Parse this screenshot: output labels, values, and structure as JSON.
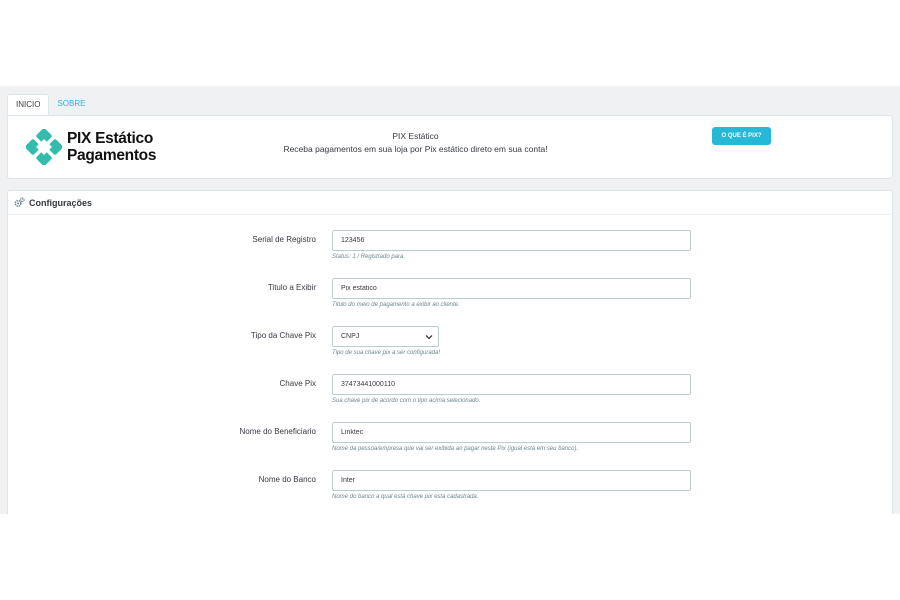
{
  "tabs": [
    {
      "label": "INICIO"
    },
    {
      "label": "SOBRE"
    }
  ],
  "hero": {
    "logo_line1": "PIX Estático",
    "logo_line2": "Pagamentos",
    "title": "PIX Estático",
    "subtitle": "Receba pagamentos em sua loja por Pix estático direto em sua conta!",
    "button_label": "O QUE É PIX?"
  },
  "config": {
    "title": "Configurações",
    "fields": [
      {
        "label": "Serial de Registro",
        "value": "123456",
        "help": "Status: 1 / Registrado para."
      },
      {
        "label": "Titulo a Exibir",
        "value": "Pix estatico",
        "help": "Titulo do meio de pagamento a exibir ao cliente."
      },
      {
        "label": "Tipo da Chave Pix",
        "value": "CNPJ",
        "help": "Tipo de sua chave pix a ser configurada!"
      },
      {
        "label": "Chave Pix",
        "value": "37473441000110",
        "help": "Sua chave pix de acordo com o tipo acima selecionado."
      },
      {
        "label": "Nome do Beneficiario",
        "value": "Linktec",
        "help": "Nome da pessoa/empresa que vai ser exibida ao pagar neste Pix (igual está em seu banco)."
      },
      {
        "label": "Nome do Banco",
        "value": "Inter",
        "help": "Nome do banco a qual está chave pix esta cadastrada."
      }
    ]
  },
  "colors": {
    "accent": "#25b9d7",
    "pix_logo": "#32bcad",
    "background": "#eff1f2"
  },
  "icons": {
    "pix_logo": "pix-diamond-logo",
    "config": "gears-icon",
    "select": "chevron-down-icon"
  }
}
